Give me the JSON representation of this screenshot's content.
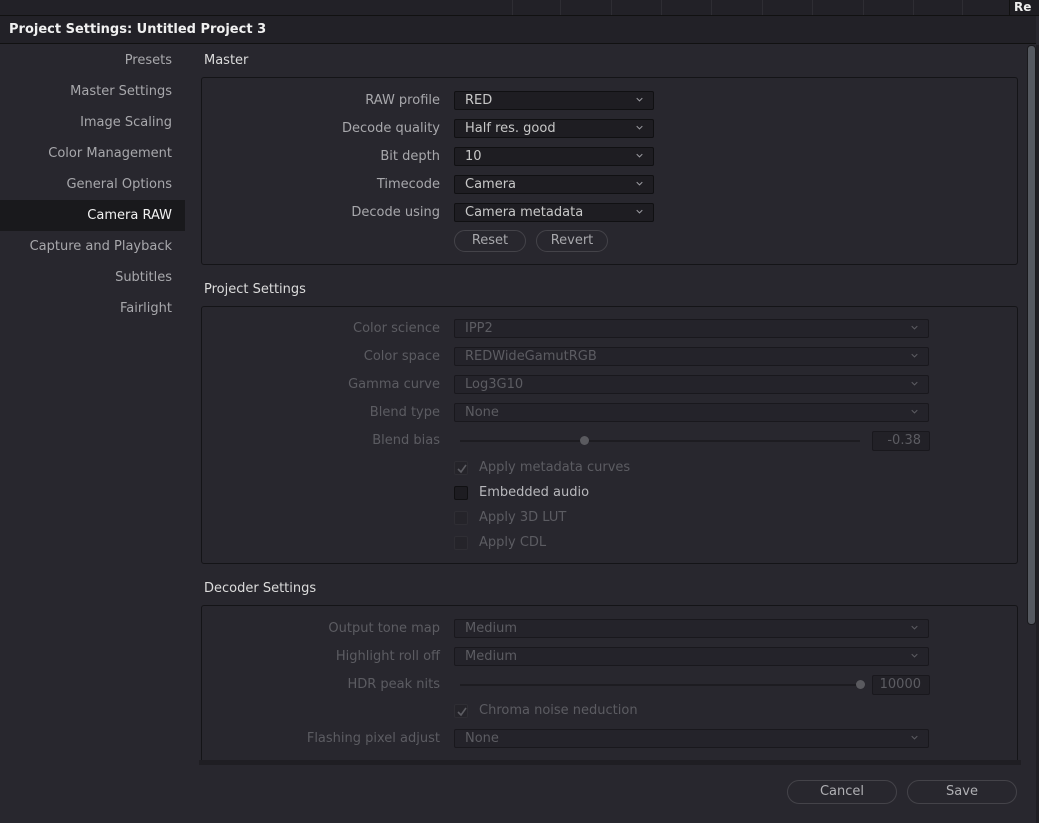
{
  "window": {
    "title": "Project Settings:  Untitled Project 3",
    "background_tab_text": "Re"
  },
  "sidebar": {
    "items": [
      {
        "label": "Presets",
        "active": false
      },
      {
        "label": "Master Settings",
        "active": false
      },
      {
        "label": "Image Scaling",
        "active": false
      },
      {
        "label": "Color Management",
        "active": false
      },
      {
        "label": "General Options",
        "active": false
      },
      {
        "label": "Camera RAW",
        "active": true
      },
      {
        "label": "Capture and Playback",
        "active": false
      },
      {
        "label": "Subtitles",
        "active": false
      },
      {
        "label": "Fairlight",
        "active": false
      }
    ]
  },
  "master": {
    "title": "Master",
    "fields": [
      {
        "label": "RAW profile",
        "value": "RED"
      },
      {
        "label": "Decode quality",
        "value": "Half res. good"
      },
      {
        "label": "Bit depth",
        "value": "10"
      },
      {
        "label": "Timecode",
        "value": "Camera"
      },
      {
        "label": "Decode using",
        "value": "Camera metadata"
      }
    ],
    "reset_label": "Reset",
    "revert_label": "Revert"
  },
  "project_settings": {
    "title": "Project Settings",
    "fields": [
      {
        "label": "Color science",
        "value": "IPP2",
        "enabled": false
      },
      {
        "label": "Color space",
        "value": "REDWideGamutRGB",
        "enabled": false
      },
      {
        "label": "Gamma curve",
        "value": "Log3G10",
        "enabled": false
      },
      {
        "label": "Blend type",
        "value": "None",
        "enabled": false
      }
    ],
    "blend_bias": {
      "label": "Blend bias",
      "value": "-0.38",
      "slider_fraction": 0.31,
      "enabled": false
    },
    "checkboxes": [
      {
        "label": "Apply metadata curves",
        "checked": true,
        "enabled": false
      },
      {
        "label": "Embedded audio",
        "checked": false,
        "enabled": true
      },
      {
        "label": "Apply 3D LUT",
        "checked": false,
        "enabled": false
      },
      {
        "label": "Apply CDL",
        "checked": false,
        "enabled": false
      }
    ]
  },
  "decoder_settings": {
    "title": "Decoder Settings",
    "output_tone_map": {
      "label": "Output tone map",
      "value": "Medium",
      "enabled": false
    },
    "highlight_roll_off": {
      "label": "Highlight roll off",
      "value": "Medium",
      "enabled": false
    },
    "hdr_peak_nits": {
      "label": "HDR peak nits",
      "value": "10000",
      "slider_fraction": 1.0,
      "enabled": false
    },
    "chroma_noise": {
      "label": "Chroma noise neduction",
      "checked": true,
      "enabled": false
    },
    "flashing_pixel": {
      "label": "Flashing pixel adjust",
      "value": "None",
      "enabled": false
    }
  },
  "footer": {
    "cancel_label": "Cancel",
    "save_label": "Save"
  }
}
